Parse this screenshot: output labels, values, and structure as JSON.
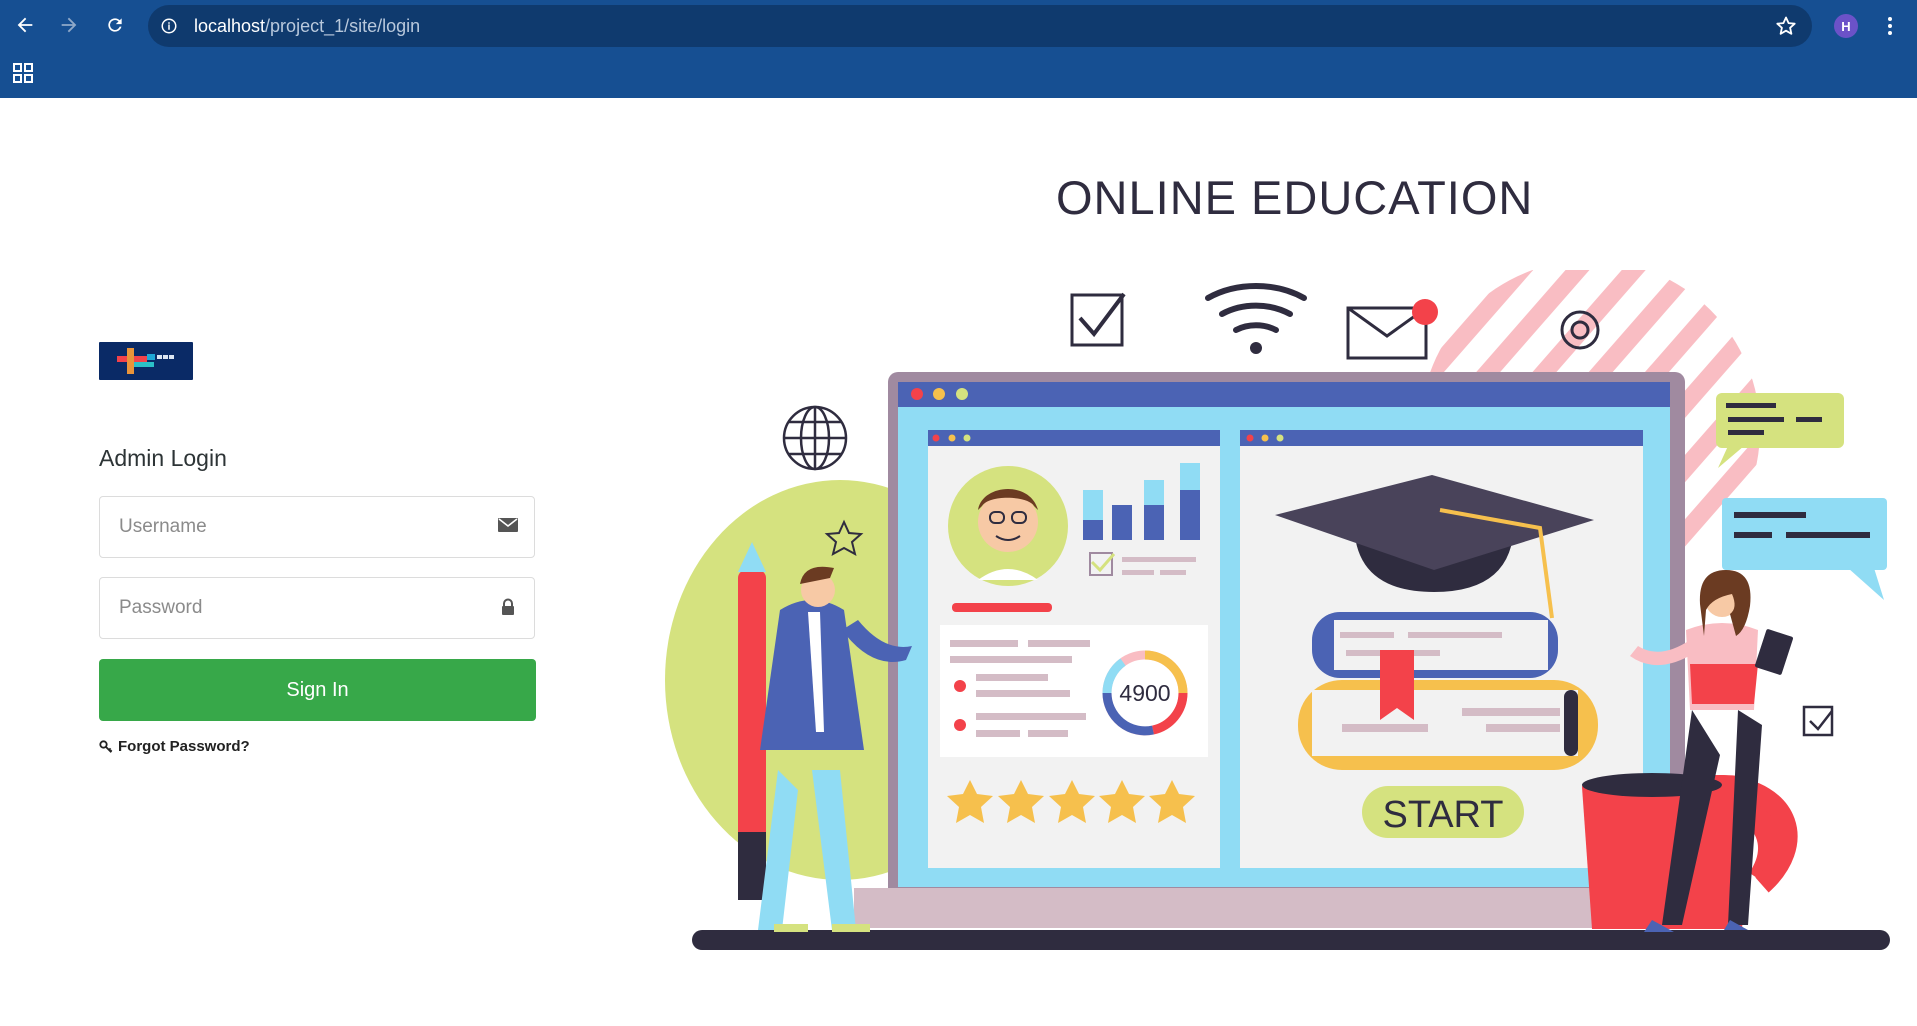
{
  "browser": {
    "url_host": "localhost",
    "url_path": "/project_1/site/login",
    "profile_initial": "H"
  },
  "login": {
    "title": "Admin Login",
    "username_placeholder": "Username",
    "username_value": "",
    "password_placeholder": "Password",
    "password_value": "",
    "sign_in_label": "Sign In",
    "forgot_label": "Forgot Password?"
  },
  "hero": {
    "title": "ONLINE EDUCATION",
    "stat_value": "4900",
    "rating_stars": 5,
    "start_label": "START"
  },
  "colors": {
    "browser_bar": "#164f92",
    "omnibox": "#0f3a6e",
    "sign_in_button": "#37a849",
    "logo_bg": "#0a2a66",
    "illustration_accent": "#f3424a"
  },
  "icons": {
    "back": "arrow-left-icon",
    "forward": "arrow-right-icon",
    "reload": "reload-icon",
    "site_info": "info-icon",
    "bookmark": "star-outline-icon",
    "menu": "kebab-menu-icon",
    "apps": "apps-grid-icon",
    "username_field": "envelope-icon",
    "password_field": "lock-icon",
    "forgot": "key-icon"
  }
}
